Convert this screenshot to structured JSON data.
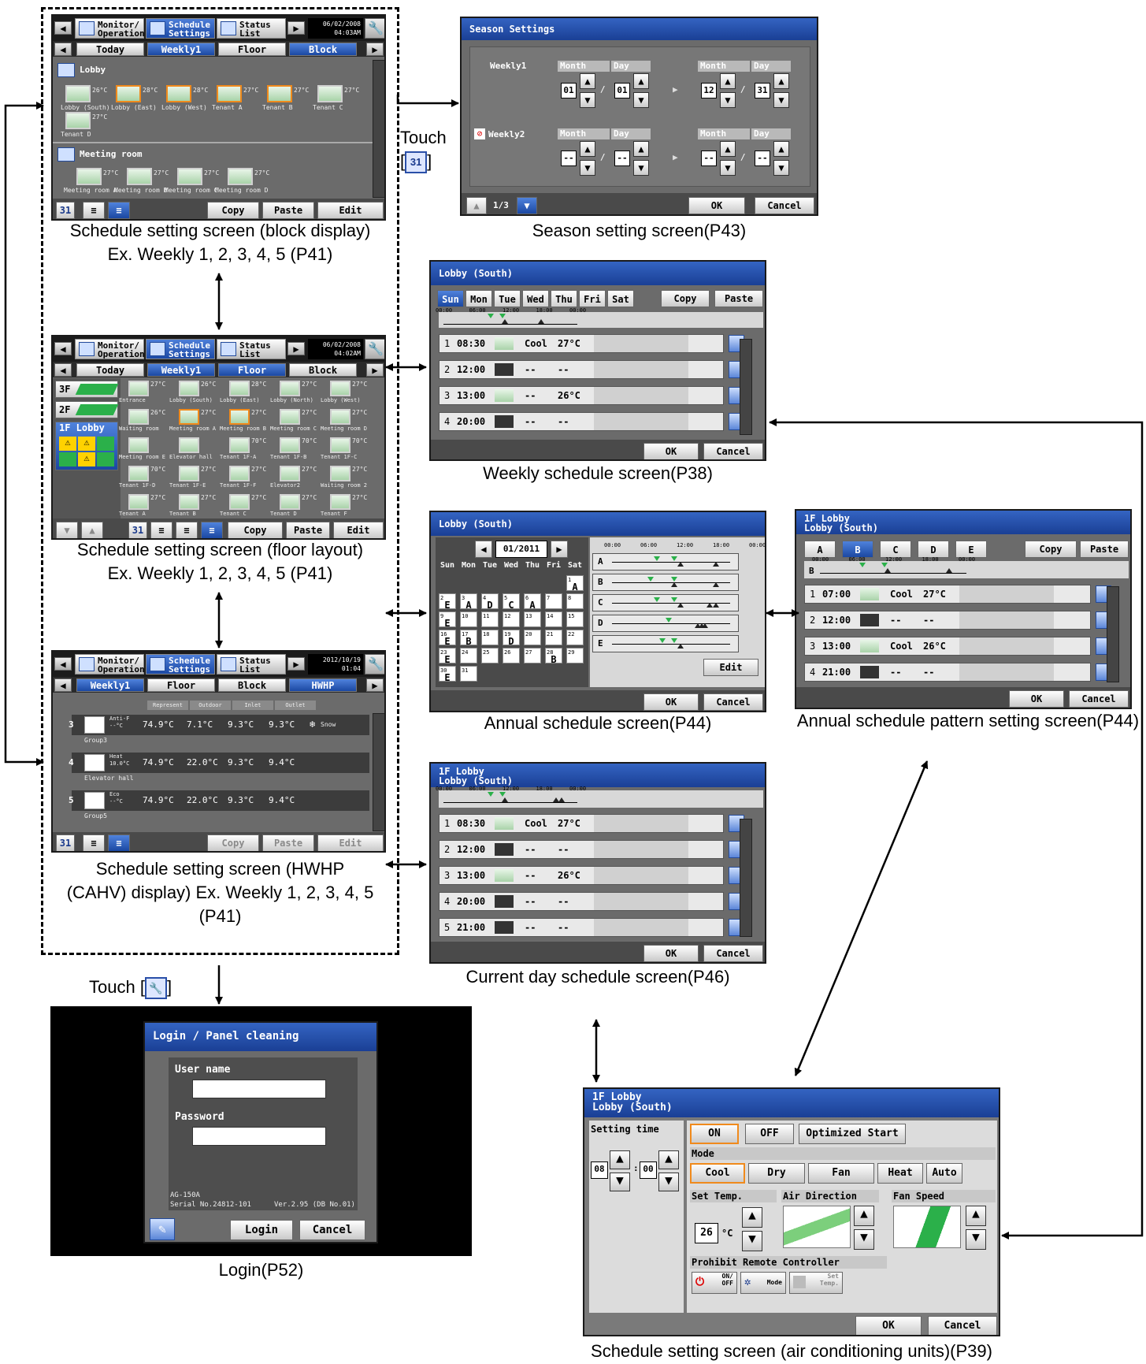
{
  "captions": {
    "block": "Schedule setting screen (block display)\nEx. Weekly 1, 2, 3, 4, 5 (P41)",
    "floor": "Schedule setting screen (floor layout)\nEx. Weekly 1, 2, 3, 4, 5 (P41)",
    "hwhp": "Schedule setting screen (HWHP\n(CAHV) display) Ex. Weekly 1, 2, 3, 4, 5\n(P41)",
    "season": "Season setting screen(P43)",
    "weekly": "Weekly schedule screen(P38)",
    "annual": "Annual schedule screen(P44)",
    "pattern": "Annual schedule pattern setting screen(P44)",
    "current": "Current day schedule screen(P46)",
    "login": "Login(P52)",
    "aircon": "Schedule setting screen (air conditioning units)(P39)"
  },
  "touch": {
    "label": "Touch",
    "calendar_icon": "31",
    "wrench_label": "Touch",
    "wrench_icon": "🔧"
  },
  "topbar": {
    "monitor": "Monitor/\nOperation",
    "schedule": "Schedule\nSettings",
    "status": "Status\nList",
    "clock1": "06/02/2008\n04:03AM",
    "clock2": "06/02/2008\n04:02AM",
    "clock3": "2012/10/19\n01:04"
  },
  "block_screen": {
    "tabs": [
      "Today",
      "Weekly1",
      "Floor",
      "Block"
    ],
    "group1": "Lobby",
    "group2": "Meeting room",
    "units1": [
      {
        "name": "Lobby (South)",
        "temp": "26°C"
      },
      {
        "name": "Lobby (East)",
        "temp": "28°C"
      },
      {
        "name": "Lobby (West)",
        "temp": "28°C"
      },
      {
        "name": "Tenant A",
        "temp": "27°C"
      },
      {
        "name": "Tenant B",
        "temp": "27°C"
      },
      {
        "name": "Tenant C",
        "temp": "27°C"
      },
      {
        "name": "Tenant D",
        "temp": "27°C"
      }
    ],
    "units2": [
      {
        "name": "Meeting room A",
        "temp": "27°C"
      },
      {
        "name": "Meeting room B",
        "temp": "27°C"
      },
      {
        "name": "Meeting room C",
        "temp": "27°C"
      },
      {
        "name": "Meeting room D",
        "temp": "27°C"
      }
    ],
    "buttons": {
      "copy": "Copy",
      "paste": "Paste",
      "edit": "Edit"
    }
  },
  "floor_screen": {
    "tabs": [
      "Today",
      "Weekly1",
      "Floor",
      "Block"
    ],
    "floors": [
      "3F",
      "2F",
      "1F Lobby"
    ],
    "units": [
      {
        "name": "Entrance",
        "temp": "27°C"
      },
      {
        "name": "Lobby (South)",
        "temp": "26°C"
      },
      {
        "name": "Lobby (East)",
        "temp": "28°C"
      },
      {
        "name": "Lobby (North)",
        "temp": "27°C"
      },
      {
        "name": "Lobby (West)",
        "temp": "27°C"
      },
      {
        "name": "Waiting room",
        "temp": "26°C"
      },
      {
        "name": "Meeting room A",
        "temp": "27°C"
      },
      {
        "name": "Meeting room B",
        "temp": "27°C"
      },
      {
        "name": "Meeting room C",
        "temp": "27°C"
      },
      {
        "name": "Meeting room D",
        "temp": "27°C"
      },
      {
        "name": "Meeting room E",
        "temp": ""
      },
      {
        "name": "Elevator hall",
        "temp": ""
      },
      {
        "name": "Tenant 1F-A",
        "temp": "70°C"
      },
      {
        "name": "Tenant 1F-B",
        "temp": "70°C"
      },
      {
        "name": "Tenant 1F-C",
        "temp": "70°C"
      },
      {
        "name": "Tenant 1F-D",
        "temp": "70°C"
      },
      {
        "name": "Tenant 1F-E",
        "temp": "27°C"
      },
      {
        "name": "Tenant 1F-F",
        "temp": "27°C"
      },
      {
        "name": "Elevator2",
        "temp": "27°C"
      },
      {
        "name": "Waiting room 2",
        "temp": "27°C"
      },
      {
        "name": "Tenant A",
        "temp": "27°C"
      },
      {
        "name": "Tenant B",
        "temp": "27°C"
      },
      {
        "name": "Tenant C",
        "temp": "27°C"
      },
      {
        "name": "Tenant D",
        "temp": "27°C"
      },
      {
        "name": "Tenant F",
        "temp": "27°C"
      }
    ],
    "buttons": {
      "copy": "Copy",
      "paste": "Paste",
      "edit": "Edit"
    }
  },
  "hwhp_screen": {
    "tabs": [
      "Weekly1",
      "Floor",
      "Block",
      "HWHP"
    ],
    "headers": [
      "Represent",
      "Outdoor",
      "Inlet",
      "Outlet"
    ],
    "rows": [
      {
        "no": "3",
        "mode": "Anti-F",
        "set": "--°C",
        "represent": "74.9°C",
        "outdoor": "7.1°C",
        "inlet": "9.3°C",
        "outlet": "9.3°C",
        "extra": "Snow",
        "group": "Group3"
      },
      {
        "no": "4",
        "mode": "Heat",
        "set": "10.0°C",
        "represent": "74.9°C",
        "outdoor": "22.0°C",
        "inlet": "9.3°C",
        "outlet": "9.4°C",
        "extra": "",
        "group": "Elevator hall"
      },
      {
        "no": "5",
        "mode": "Eco",
        "set": "--°C",
        "represent": "74.9°C",
        "outdoor": "22.0°C",
        "inlet": "9.3°C",
        "outlet": "9.4°C",
        "extra": "",
        "group": "Group5"
      }
    ],
    "buttons": {
      "copy": "Copy",
      "paste": "Paste",
      "edit": "Edit"
    }
  },
  "season_screen": {
    "title": "Season Settings",
    "weekly1": "Weekly1",
    "weekly2": "Weekly2",
    "month": "Month",
    "day": "Day",
    "w1": {
      "from_m": "01",
      "from_d": "01",
      "to_m": "12",
      "to_d": "31"
    },
    "w2": {
      "from_m": "--",
      "from_d": "--",
      "to_m": "--",
      "to_d": "--"
    },
    "page": "1/3",
    "ok": "OK",
    "cancel": "Cancel"
  },
  "weekly_screen": {
    "title": "Lobby (South)",
    "days": [
      "Sun",
      "Mon",
      "Tue",
      "Wed",
      "Thu",
      "Fri",
      "Sat"
    ],
    "copy": "Copy",
    "paste": "Paste",
    "times_axis": [
      "00:00",
      "06:00",
      "12:00",
      "18:00",
      "00:00"
    ],
    "rows": [
      {
        "no": "1",
        "time": "08:30",
        "mode": "Cool",
        "temp": "27°C"
      },
      {
        "no": "2",
        "time": "12:00",
        "mode": "--",
        "temp": "--"
      },
      {
        "no": "3",
        "time": "13:00",
        "mode": "--",
        "temp": "26°C"
      },
      {
        "no": "4",
        "time": "20:00",
        "mode": "--",
        "temp": "--"
      }
    ],
    "ok": "OK",
    "cancel": "Cancel"
  },
  "annual_screen": {
    "title": "Lobby (South)",
    "month": "01/2011",
    "days": [
      "Sun",
      "Mon",
      "Tue",
      "Wed",
      "Thu",
      "Fri",
      "Sat"
    ],
    "calendar": [
      [
        {
          "d": "",
          "p": ""
        },
        {
          "d": "",
          "p": ""
        },
        {
          "d": "",
          "p": ""
        },
        {
          "d": "",
          "p": ""
        },
        {
          "d": "",
          "p": ""
        },
        {
          "d": "",
          "p": ""
        },
        {
          "d": "1",
          "p": "A"
        }
      ],
      [
        {
          "d": "2",
          "p": "E"
        },
        {
          "d": "3",
          "p": "A"
        },
        {
          "d": "4",
          "p": "D"
        },
        {
          "d": "5",
          "p": "C"
        },
        {
          "d": "6",
          "p": "A"
        },
        {
          "d": "7",
          "p": ""
        },
        {
          "d": "8",
          "p": ""
        }
      ],
      [
        {
          "d": "9",
          "p": "E"
        },
        {
          "d": "10",
          "p": ""
        },
        {
          "d": "11",
          "p": ""
        },
        {
          "d": "12",
          "p": ""
        },
        {
          "d": "13",
          "p": ""
        },
        {
          "d": "14",
          "p": ""
        },
        {
          "d": "15",
          "p": ""
        }
      ],
      [
        {
          "d": "16",
          "p": "E"
        },
        {
          "d": "17",
          "p": "B"
        },
        {
          "d": "18",
          "p": ""
        },
        {
          "d": "19",
          "p": "D"
        },
        {
          "d": "20",
          "p": ""
        },
        {
          "d": "21",
          "p": ""
        },
        {
          "d": "22",
          "p": ""
        }
      ],
      [
        {
          "d": "23",
          "p": "E"
        },
        {
          "d": "24",
          "p": ""
        },
        {
          "d": "25",
          "p": ""
        },
        {
          "d": "26",
          "p": ""
        },
        {
          "d": "27",
          "p": ""
        },
        {
          "d": "28",
          "p": "B"
        },
        {
          "d": "29",
          "p": ""
        }
      ],
      [
        {
          "d": "30",
          "p": "E"
        },
        {
          "d": "31",
          "p": ""
        },
        {
          "d": "",
          "p": ""
        },
        {
          "d": "",
          "p": ""
        },
        {
          "d": "",
          "p": ""
        },
        {
          "d": "",
          "p": ""
        },
        {
          "d": "",
          "p": ""
        }
      ]
    ],
    "patterns": [
      "A",
      "B",
      "C",
      "D",
      "E"
    ],
    "times_axis": [
      "00:00",
      "06:00",
      "12:00",
      "18:00",
      "00:00"
    ],
    "edit": "Edit",
    "ok": "OK",
    "cancel": "Cancel"
  },
  "pattern_screen": {
    "title": "1F Lobby\nLobby (South)",
    "patterns": [
      "A",
      "B",
      "C",
      "D",
      "E"
    ],
    "copy": "Copy",
    "paste": "Paste",
    "current": "B",
    "times_axis": [
      "00:00",
      "06:00",
      "12:00",
      "18:00",
      "00:00"
    ],
    "rows": [
      {
        "no": "1",
        "time": "07:00",
        "mode": "Cool",
        "temp": "27°C"
      },
      {
        "no": "2",
        "time": "12:00",
        "mode": "--",
        "temp": "--"
      },
      {
        "no": "3",
        "time": "13:00",
        "mode": "Cool",
        "temp": "26°C"
      },
      {
        "no": "4",
        "time": "21:00",
        "mode": "--",
        "temp": "--"
      }
    ],
    "ok": "OK",
    "cancel": "Cancel"
  },
  "current_screen": {
    "title": "1F Lobby\nLobby (South)",
    "times_axis": [
      "00:00",
      "06:00",
      "12:00",
      "18:00",
      "00:00"
    ],
    "rows": [
      {
        "no": "1",
        "time": "08:30",
        "mode": "Cool",
        "temp": "27°C"
      },
      {
        "no": "2",
        "time": "12:00",
        "mode": "--",
        "temp": "--"
      },
      {
        "no": "3",
        "time": "13:00",
        "mode": "--",
        "temp": "26°C"
      },
      {
        "no": "4",
        "time": "20:00",
        "mode": "--",
        "temp": "--"
      },
      {
        "no": "5",
        "time": "21:00",
        "mode": "--",
        "temp": "--"
      }
    ],
    "ok": "OK",
    "cancel": "Cancel"
  },
  "login_screen": {
    "title": "Login / Panel cleaning",
    "user": "User name",
    "password": "Password",
    "model": "AG-150A",
    "serial": "Serial No.24812-101",
    "version": "Ver.2.95 (DB No.01)",
    "login": "Login",
    "cancel": "Cancel"
  },
  "aircon_screen": {
    "title": "1F Lobby\nLobby (South)",
    "setting_time": "Setting time",
    "hour": "08",
    "minute": "00",
    "on": "ON",
    "off": "OFF",
    "optimized": "Optimized Start",
    "mode_label": "Mode",
    "modes": [
      "Cool",
      "Dry",
      "Fan",
      "Heat",
      "Auto"
    ],
    "set_temp_label": "Set Temp.",
    "set_temp": "26",
    "unit": "°C",
    "air_direction": "Air Direction",
    "fan_speed": "Fan Speed",
    "prohibit": "Prohibit Remote Controller",
    "prohibit_onoff": "ON/\nOFF",
    "prohibit_mode": "Mode",
    "prohibit_temp": "Set\nTemp.",
    "ok": "OK",
    "cancel": "Cancel"
  },
  "colors": {
    "accent": "#1b48a2",
    "select": "#f08a1c",
    "panel": "#6b6b6b"
  }
}
